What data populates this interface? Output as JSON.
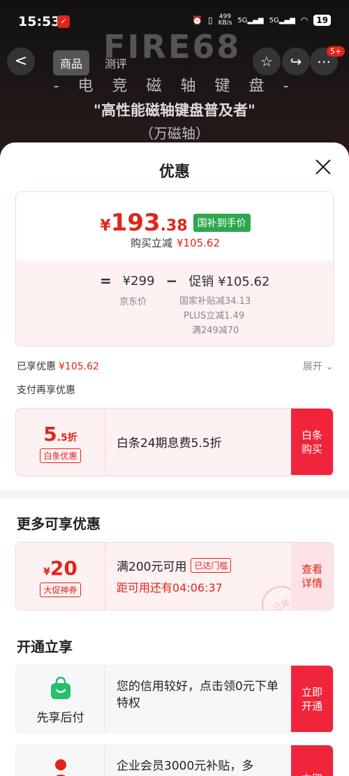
{
  "status_bar": {
    "time": "15:53",
    "speed_value": "499",
    "speed_unit": "KB/s",
    "net1": "5G",
    "net2": "5G",
    "battery": "19"
  },
  "header": {
    "brand": "FIRE68",
    "back": "<",
    "tabs": [
      "商品",
      "测评"
    ],
    "badge": "5+",
    "hero": [
      "- 电 竞 磁 轴 键 盘 -",
      "\"高性能磁轴键盘普及者\"",
      "（万磁轴）"
    ]
  },
  "sheet": {
    "title": "优惠",
    "price": {
      "yen": "¥",
      "int": "193",
      "dec": ".38",
      "gov_badge": "国补到手价",
      "sub_label": "购买立减",
      "sub_value": "¥105.62",
      "calc_eq": "=",
      "calc_jd": "¥299",
      "calc_minus": "−",
      "calc_promo": "促销 ¥105.62",
      "jd_label": "京东价",
      "promo_lines": [
        "国家补贴减34.13",
        "PLUS立减1.49",
        "满249减70"
      ]
    },
    "enjoyed_label": "已享优惠",
    "enjoyed_value": "¥105.62",
    "expand_label": "展开",
    "pay_more": "支付再享优惠",
    "baitiao": {
      "discount_big": "5",
      "discount_small": ".5折",
      "tag": "白条优惠",
      "desc": "白条24期息费5.5折",
      "btn": [
        "白条",
        "购买"
      ]
    },
    "more_title": "更多可享优惠",
    "coupon": {
      "yen": "¥",
      "amount": "20",
      "tag": "大促神券",
      "condition": "满200元可用",
      "reached": "已达门槛",
      "countdown": "距可用还有04:06:37",
      "btn": [
        "查看",
        "详情"
      ],
      "stamp": "已领"
    },
    "open_title": "开通立享",
    "services": [
      {
        "name": "先享后付",
        "desc": "您的信用较好，点击领0元下单特权",
        "btn": [
          "立即",
          "开通"
        ]
      },
      {
        "name": "",
        "desc": "企业会员3000元补贴，多",
        "btn": [
          "立即",
          ""
        ]
      }
    ]
  }
}
